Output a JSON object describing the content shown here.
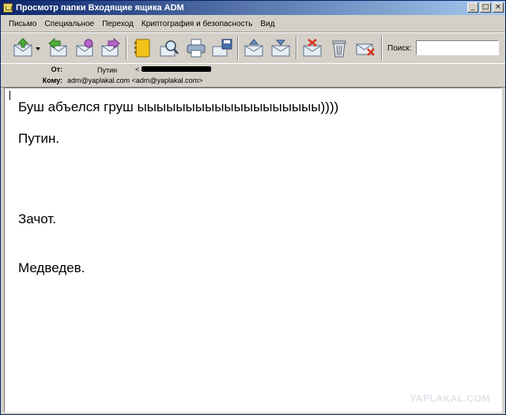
{
  "window": {
    "title": "Просмотр папки Входящие ящика ADM",
    "controls": {
      "minimize": "_",
      "maximize": "□",
      "close": "×"
    }
  },
  "menu": {
    "items": [
      "Письмо",
      "Специальное",
      "Переход",
      "Криптография и безопасность",
      "Вид"
    ]
  },
  "toolbar": {
    "buttons": [
      {
        "name": "get-mail-icon"
      },
      {
        "name": "reply-icon"
      },
      {
        "name": "reply-all-icon"
      },
      {
        "name": "forward-icon"
      },
      {
        "name": "address-book-icon"
      },
      {
        "name": "find-icon"
      },
      {
        "name": "print-icon"
      },
      {
        "name": "save-icon"
      },
      {
        "name": "move-up-icon"
      },
      {
        "name": "move-down-icon"
      },
      {
        "name": "mark-icon"
      },
      {
        "name": "trash-icon"
      },
      {
        "name": "delete-icon"
      }
    ],
    "search_label": "Поиск:",
    "search_value": ""
  },
  "header": {
    "from_label": "От:",
    "from_name": "Путин",
    "from_bracket": "<",
    "to_label": "Кому:",
    "to_value": "adm@yaplakal.com <adm@yaplakal.com>"
  },
  "message": {
    "lines": [
      "Буш абъелся груш ыыыыыыыыыыыыыыыыыыы))))",
      "Путин.",
      "Зачот.",
      "Медведев."
    ]
  },
  "watermark": "YAPLAKAL.COM",
  "colors": {
    "titlebar_start": "#0a246a",
    "titlebar_end": "#a6caf0",
    "chrome": "#d4d0c8"
  }
}
